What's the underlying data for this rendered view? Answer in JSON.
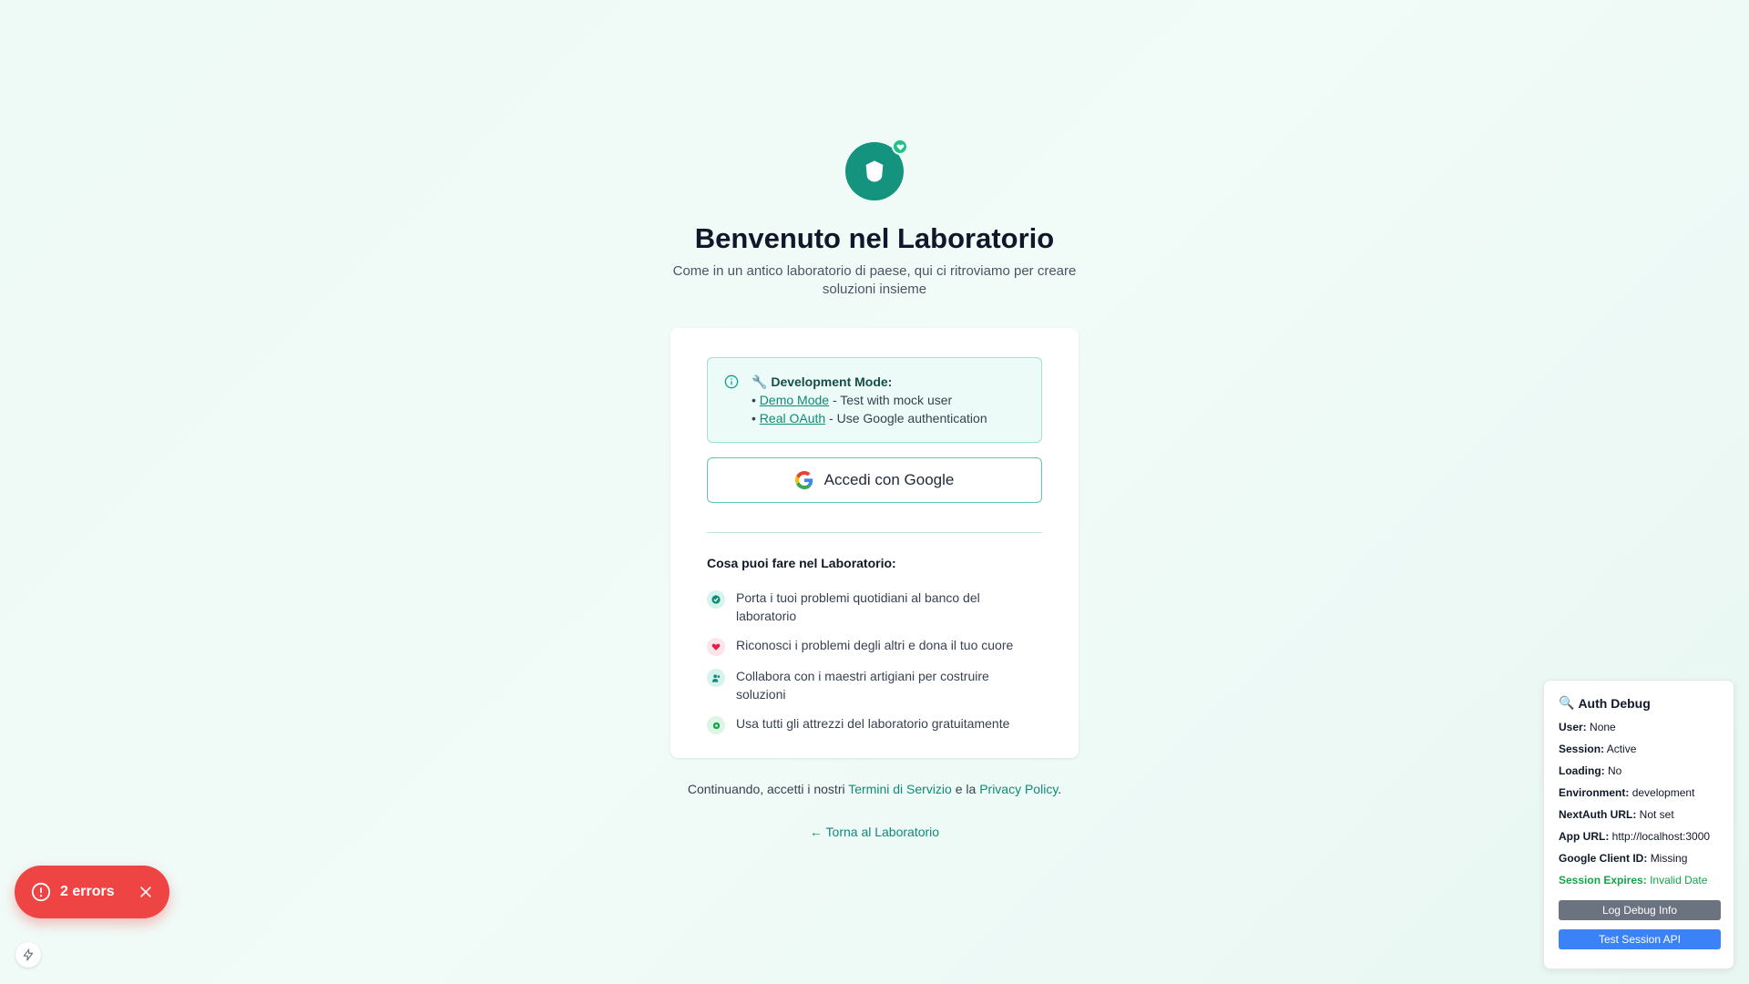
{
  "header": {
    "title": "Benvenuto nel Laboratorio",
    "subtitle": "Come in un antico laboratorio di paese, qui ci ritroviamo per creare soluzioni insieme"
  },
  "dev_mode": {
    "title_icon": "🔧",
    "title": "Development Mode:",
    "items": [
      {
        "bullet": "•",
        "link": "Demo Mode",
        "text": " - Test with mock user"
      },
      {
        "bullet": "•",
        "link": "Real OAuth",
        "text": " - Use Google authentication"
      }
    ]
  },
  "google_button": {
    "label": "Accedi con Google"
  },
  "features": {
    "title": "Cosa puoi fare nel Laboratorio:",
    "items": [
      {
        "text": "Porta i tuoi problemi quotidiani al banco del laboratorio",
        "icon": "check-icon",
        "color": "#0f8a77",
        "bg": "#d6f3ec"
      },
      {
        "text": "Riconosci i problemi degli altri e dona il tuo cuore",
        "icon": "heart-icon",
        "color": "#e11d48",
        "bg": "#fde4e9"
      },
      {
        "text": "Collabora con i maestri artigiani per costruire soluzioni",
        "icon": "users-icon",
        "color": "#0f8a77",
        "bg": "#d6f3ec"
      },
      {
        "text": "Usa tutti gli attrezzi del laboratorio gratuitamente",
        "icon": "gear-icon",
        "color": "#16a34a",
        "bg": "#dcf5e6"
      }
    ]
  },
  "terms": {
    "prefix": "Continuando, accetti i nostri ",
    "terms_link": "Termini di Servizio",
    "middle": " e la ",
    "privacy_link": "Privacy Policy",
    "suffix": "."
  },
  "back_link": "← Torna al Laboratorio",
  "errors": {
    "label": "2 errors"
  },
  "debug": {
    "title_icon": "🔍",
    "title": "Auth Debug",
    "rows": [
      {
        "key": "User:",
        "value": "None"
      },
      {
        "key": "Session:",
        "value": "Active"
      },
      {
        "key": "Loading:",
        "value": "No"
      },
      {
        "key": "Environment:",
        "value": "development"
      },
      {
        "key": "NextAuth URL:",
        "value": "Not set"
      },
      {
        "key": "App URL:",
        "value": "http://localhost:3000"
      },
      {
        "key": "Google Client ID:",
        "value": "Missing"
      },
      {
        "key": "Session Expires:",
        "value": "Invalid Date"
      }
    ],
    "log_button": "Log Debug Info",
    "test_button": "Test Session API"
  },
  "colors": {
    "brand": "#14937f",
    "error": "#ef4444",
    "debug_gray": "#6b7280",
    "debug_blue": "#3b82f6"
  }
}
